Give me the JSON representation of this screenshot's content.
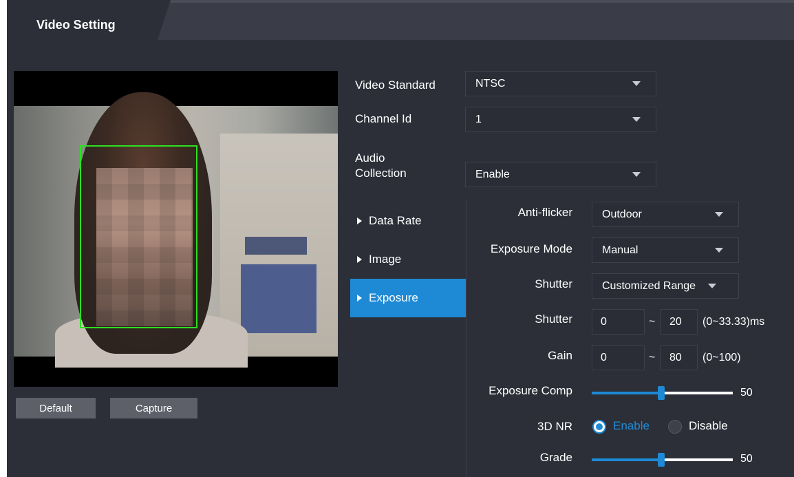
{
  "header": {
    "tab_label": "Video Setting"
  },
  "buttons": {
    "default": "Default",
    "capture": "Capture"
  },
  "form": {
    "video_standard": {
      "label": "Video Standard",
      "value": "NTSC"
    },
    "channel_id": {
      "label": "Channel Id",
      "value": "1"
    },
    "audio_collection": {
      "label_line1": "Audio",
      "label_line2": "Collection",
      "value": "Enable"
    }
  },
  "menu": {
    "items": [
      {
        "label": "Data Rate"
      },
      {
        "label": "Image"
      },
      {
        "label": "Exposure"
      }
    ],
    "active": "Exposure"
  },
  "exposure": {
    "anti_flicker": {
      "label": "Anti-flicker",
      "value": "Outdoor"
    },
    "exposure_mode": {
      "label": "Exposure Mode",
      "value": "Manual"
    },
    "shutter_mode": {
      "label": "Shutter",
      "value": "Customized Range"
    },
    "shutter_range": {
      "label": "Shutter",
      "min": "0",
      "max": "20",
      "hint": "(0~33.33)ms"
    },
    "gain": {
      "label": "Gain",
      "min": "0",
      "max": "80",
      "hint": "(0~100)"
    },
    "exposure_comp": {
      "label": "Exposure Comp",
      "value": "50"
    },
    "nr3d": {
      "label": "3D NR",
      "enable_label": "Enable",
      "disable_label": "Disable",
      "selected": "Enable"
    },
    "grade": {
      "label": "Grade",
      "value": "50"
    },
    "tilde": "~"
  },
  "colors": {
    "accent": "#1e8ad6",
    "face_box": "#2de021",
    "panel_bg": "#2c2f38"
  }
}
